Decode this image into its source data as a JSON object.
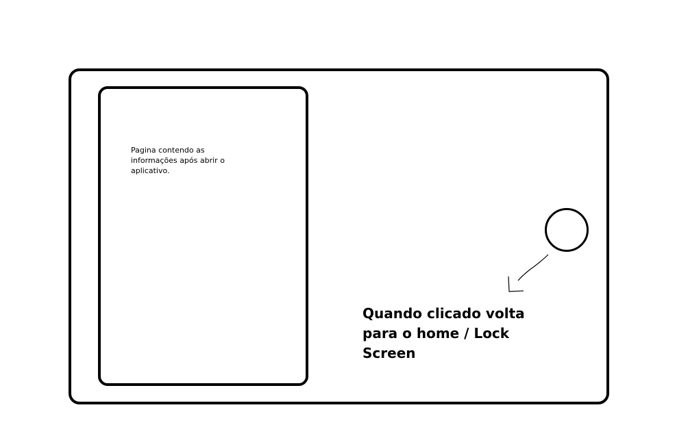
{
  "screen": {
    "note": "Pagina contendo as\ninformações após abrir o\naplicativo."
  },
  "home_button": {
    "callout": "Quando clicado volta\npara o home / Lock\nScreen"
  }
}
